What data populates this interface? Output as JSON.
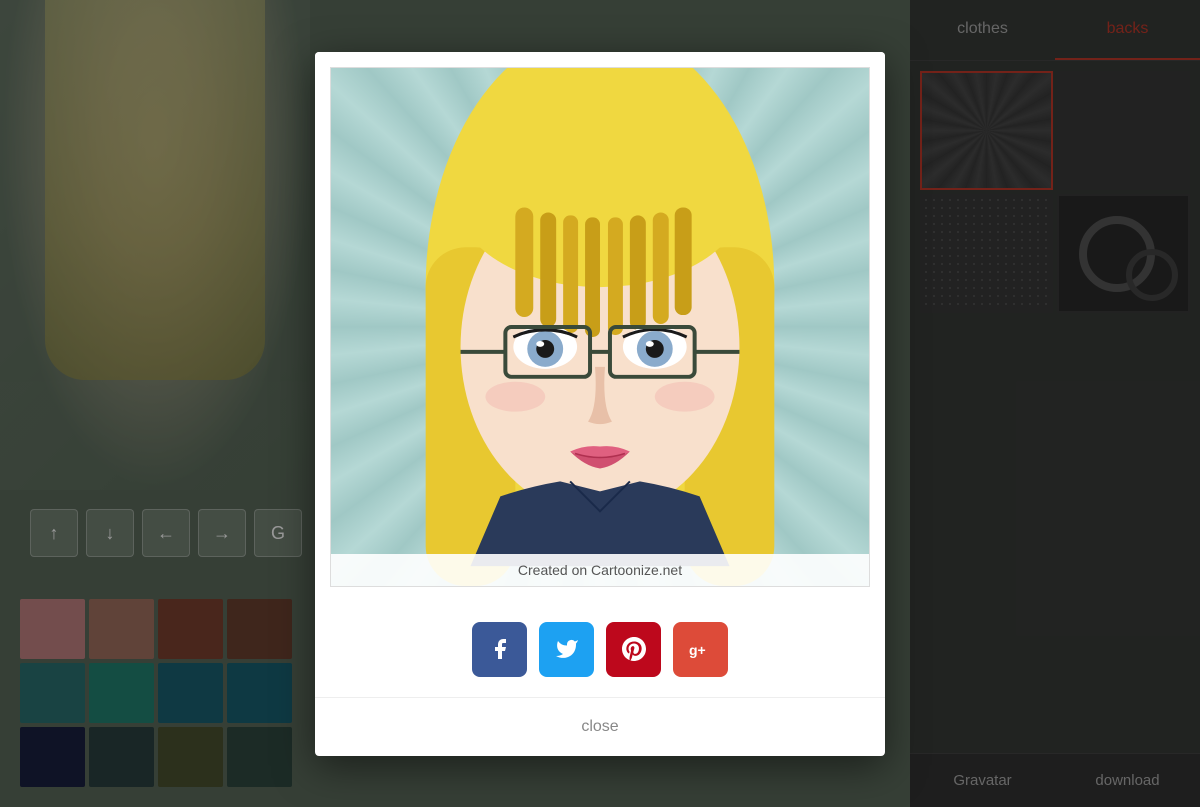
{
  "tabs": {
    "clothes": "clothes",
    "backs": "backs"
  },
  "avatar": {
    "credit": "Created on Cartoonize.net"
  },
  "social": {
    "facebook_label": "f",
    "twitter_label": "t",
    "pinterest_label": "p",
    "googleplus_label": "g+"
  },
  "modal": {
    "close_label": "close"
  },
  "bottom_buttons": {
    "gravatar": "Gravatar",
    "download": "download"
  },
  "toolbar": {
    "up": "↑",
    "down": "↓",
    "back": "←",
    "forward": "→",
    "extra": "G"
  },
  "colors": [
    "#c08080",
    "#a07060",
    "#7a4030",
    "#6a4030",
    "#2a7070",
    "#228070",
    "#1a6070",
    "#186070",
    "#1a2040",
    "#2a4040",
    "#4a5030",
    "#304840"
  ]
}
